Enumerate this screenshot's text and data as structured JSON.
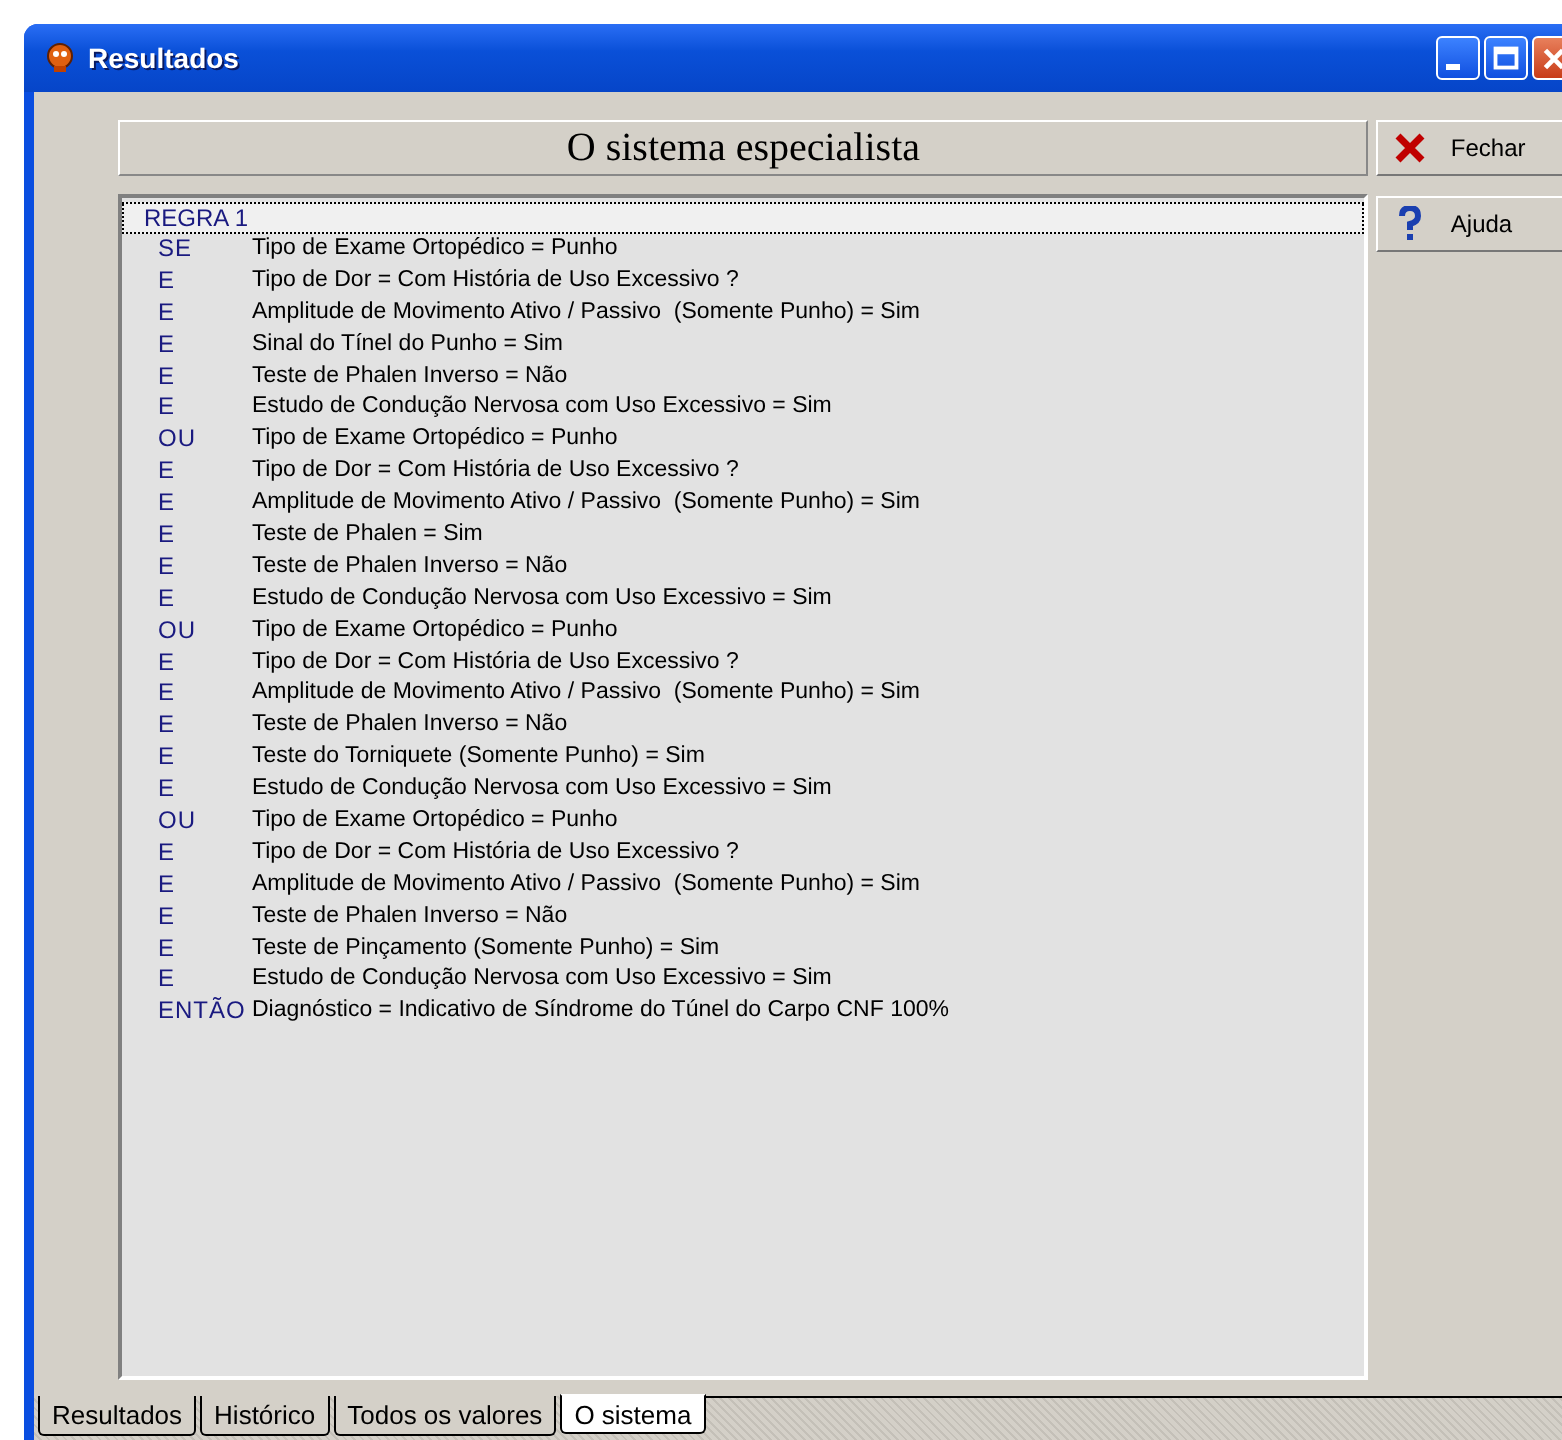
{
  "window": {
    "title": "Resultados"
  },
  "heading": "O sistema especialista",
  "rule": {
    "label": "REGRA 1",
    "selected": true
  },
  "lines": [
    {
      "keyword": "SE",
      "text": "Tipo de Exame Ortopédico = Punho"
    },
    {
      "keyword": "E",
      "text": "Tipo de Dor = Com História de Uso Excessivo ?"
    },
    {
      "keyword": "E",
      "text": "Amplitude de Movimento Ativo / Passivo  (Somente Punho) = Sim"
    },
    {
      "keyword": "E",
      "text": "Sinal do Tínel do Punho = Sim"
    },
    {
      "keyword": "E",
      "text": "Teste de Phalen Inverso = Não"
    },
    {
      "keyword": "E",
      "text": "Estudo de Condução Nervosa com Uso Excessivo = Sim"
    },
    {
      "keyword": "OU",
      "text": "Tipo de Exame Ortopédico = Punho"
    },
    {
      "keyword": "E",
      "text": "Tipo de Dor = Com História de Uso Excessivo ?"
    },
    {
      "keyword": "E",
      "text": "Amplitude de Movimento Ativo / Passivo  (Somente Punho) = Sim"
    },
    {
      "keyword": "E",
      "text": "Teste de Phalen = Sim"
    },
    {
      "keyword": "E",
      "text": "Teste de Phalen Inverso = Não"
    },
    {
      "keyword": "E",
      "text": "Estudo de Condução Nervosa com Uso Excessivo = Sim"
    },
    {
      "keyword": "OU",
      "text": "Tipo de Exame Ortopédico = Punho"
    },
    {
      "keyword": "E",
      "text": "Tipo de Dor = Com História de Uso Excessivo ?"
    },
    {
      "keyword": "E",
      "text": "Amplitude de Movimento Ativo / Passivo  (Somente Punho) = Sim"
    },
    {
      "keyword": "E",
      "text": "Teste de Phalen Inverso = Não"
    },
    {
      "keyword": "E",
      "text": "Teste do Torniquete (Somente Punho) = Sim"
    },
    {
      "keyword": "E",
      "text": "Estudo de Condução Nervosa com Uso Excessivo = Sim"
    },
    {
      "keyword": "OU",
      "text": "Tipo de Exame Ortopédico = Punho"
    },
    {
      "keyword": "E",
      "text": "Tipo de Dor = Com História de Uso Excessivo ?"
    },
    {
      "keyword": "E",
      "text": "Amplitude de Movimento Ativo / Passivo  (Somente Punho) = Sim"
    },
    {
      "keyword": "E",
      "text": "Teste de Phalen Inverso = Não"
    },
    {
      "keyword": "E",
      "text": "Teste de Pinçamento (Somente Punho) = Sim"
    },
    {
      "keyword": "E",
      "text": "Estudo de Condução Nervosa com Uso Excessivo = Sim"
    },
    {
      "keyword": "ENTÃO",
      "text": "Diagnóstico = Indicativo de Síndrome do Túnel do Carpo CNF 100%"
    }
  ],
  "buttons": [
    {
      "label": "Fechar",
      "kind": "close"
    },
    {
      "label": "Ajuda",
      "kind": "help"
    }
  ],
  "tabs": [
    {
      "label": "Resultados",
      "selected": false
    },
    {
      "label": "Histórico",
      "selected": false
    },
    {
      "label": "Todos os valores",
      "selected": false
    },
    {
      "label": "O sistema",
      "selected": true
    }
  ]
}
